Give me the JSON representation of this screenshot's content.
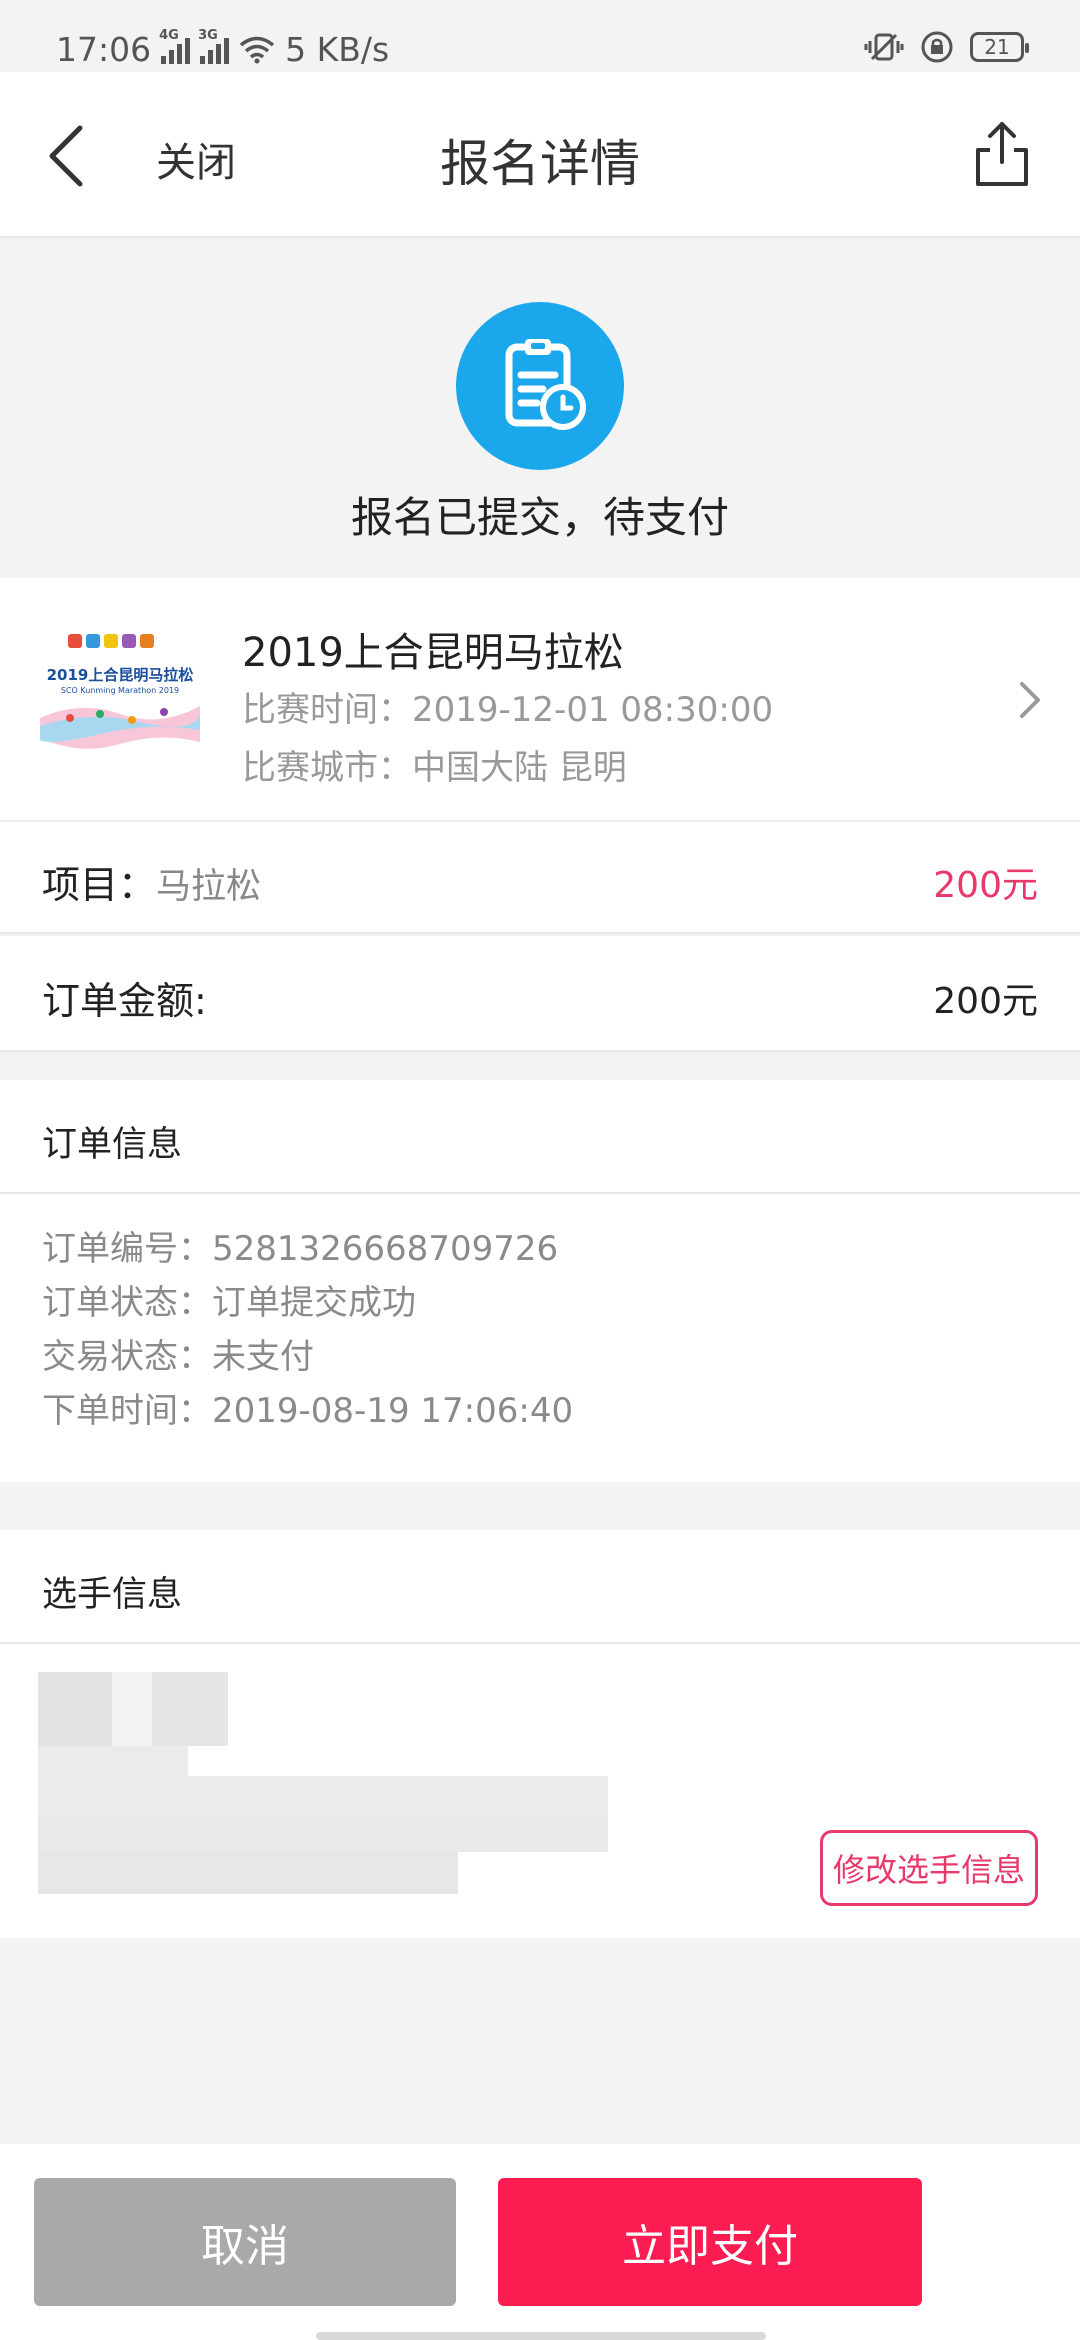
{
  "status_bar": {
    "time": "17:06",
    "network_4g": "4G",
    "network_3g": "3G",
    "speed": "5 KB/s",
    "battery": "21"
  },
  "nav": {
    "close_label": "关闭",
    "title": "报名详情",
    "back_icon": "chevron-left-icon",
    "share_icon": "share-icon"
  },
  "hero": {
    "icon": "clipboard-clock-icon",
    "status_text": "报名已提交，待支付",
    "icon_color": "#1aa7ec"
  },
  "event": {
    "name": "2019上合昆明马拉松",
    "time_label": "比赛时间：2019-12-01 08:30:00",
    "city_label": "比赛城市：中国大陆 昆明",
    "poster_title": "2019上合昆明马拉松",
    "poster_subtitle": "SCO Kunming Marathon 2019"
  },
  "project_row": {
    "label": "项目：",
    "value_name": "马拉松",
    "price": "200元",
    "price_color": "#e8396a"
  },
  "order_amount_row": {
    "label": "订单金额:",
    "value": "200元"
  },
  "order_info": {
    "heading": "订单信息",
    "lines": [
      "订单编号：5281326668709726",
      "订单状态：订单提交成功",
      "交易状态：未支付",
      "下单时间：2019-08-19 17:06:40"
    ]
  },
  "player_info": {
    "heading": "选手信息",
    "edit_button": "修改选手信息"
  },
  "bottom": {
    "cancel_label": "取消",
    "pay_label": "立即支付",
    "pay_color": "#fb1d52"
  }
}
